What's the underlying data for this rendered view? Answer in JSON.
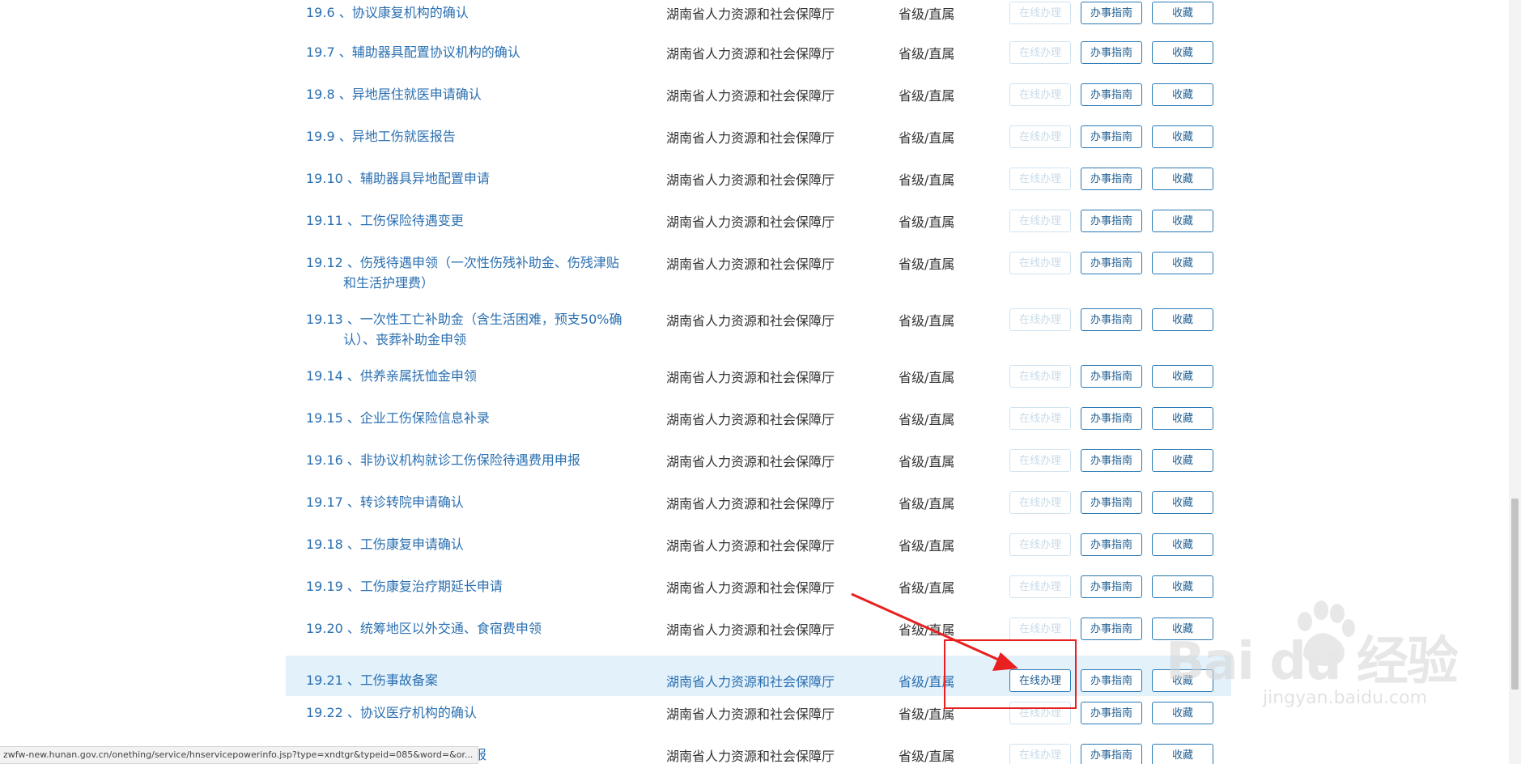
{
  "rows": [
    {
      "num": "19.6",
      "title": [
        "、协议康复机构的确认"
      ],
      "dept": "湖南省人力资源和社会保障厅",
      "level": "省级/直属",
      "online_enabled": false,
      "highlight": false
    },
    {
      "num": "19.7",
      "title": [
        "、辅助器具配置协议机构的确认"
      ],
      "dept": "湖南省人力资源和社会保障厅",
      "level": "省级/直属",
      "online_enabled": false,
      "highlight": false
    },
    {
      "num": "19.8",
      "title": [
        "、异地居住就医申请确认"
      ],
      "dept": "湖南省人力资源和社会保障厅",
      "level": "省级/直属",
      "online_enabled": false,
      "highlight": false
    },
    {
      "num": "19.9",
      "title": [
        "、异地工伤就医报告"
      ],
      "dept": "湖南省人力资源和社会保障厅",
      "level": "省级/直属",
      "online_enabled": false,
      "highlight": false
    },
    {
      "num": "19.10",
      "title": [
        "、辅助器具异地配置申请"
      ],
      "dept": "湖南省人力资源和社会保障厅",
      "level": "省级/直属",
      "online_enabled": false,
      "highlight": false
    },
    {
      "num": "19.11",
      "title": [
        "、工伤保险待遇变更"
      ],
      "dept": "湖南省人力资源和社会保障厅",
      "level": "省级/直属",
      "online_enabled": false,
      "highlight": false
    },
    {
      "num": "19.12",
      "title": [
        "、伤残待遇申领（一次性伤残补助金、伤残津贴",
        "和生活护理费）"
      ],
      "dept": "湖南省人力资源和社会保障厅",
      "level": "省级/直属",
      "online_enabled": false,
      "highlight": false
    },
    {
      "num": "19.13",
      "title": [
        "、一次性工亡补助金（含生活困难，预支50%确",
        "认）、丧葬补助金申领"
      ],
      "dept": "湖南省人力资源和社会保障厅",
      "level": "省级/直属",
      "online_enabled": false,
      "highlight": false
    },
    {
      "num": "19.14",
      "title": [
        "、供养亲属抚恤金申领"
      ],
      "dept": "湖南省人力资源和社会保障厅",
      "level": "省级/直属",
      "online_enabled": false,
      "highlight": false
    },
    {
      "num": "19.15",
      "title": [
        "、企业工伤保险信息补录"
      ],
      "dept": "湖南省人力资源和社会保障厅",
      "level": "省级/直属",
      "online_enabled": false,
      "highlight": false
    },
    {
      "num": "19.16",
      "title": [
        "、非协议机构就诊工伤保险待遇费用申报"
      ],
      "dept": "湖南省人力资源和社会保障厅",
      "level": "省级/直属",
      "online_enabled": false,
      "highlight": false
    },
    {
      "num": "19.17",
      "title": [
        "、转诊转院申请确认"
      ],
      "dept": "湖南省人力资源和社会保障厅",
      "level": "省级/直属",
      "online_enabled": false,
      "highlight": false
    },
    {
      "num": "19.18",
      "title": [
        "、工伤康复申请确认"
      ],
      "dept": "湖南省人力资源和社会保障厅",
      "level": "省级/直属",
      "online_enabled": false,
      "highlight": false
    },
    {
      "num": "19.19",
      "title": [
        "、工伤康复治疗期延长申请"
      ],
      "dept": "湖南省人力资源和社会保障厅",
      "level": "省级/直属",
      "online_enabled": false,
      "highlight": false
    },
    {
      "num": "19.20",
      "title": [
        "、统筹地区以外交通、食宿费申领"
      ],
      "dept": "湖南省人力资源和社会保障厅",
      "level": "省级/直属",
      "online_enabled": false,
      "highlight": false
    },
    {
      "num": "19.21",
      "title": [
        "、工伤事故备案"
      ],
      "dept": "湖南省人力资源和社会保障厅",
      "level": "省级/直属",
      "online_enabled": true,
      "highlight": true
    },
    {
      "num": "19.22",
      "title": [
        "、协议医疗机构的确认"
      ],
      "dept": "湖南省人力资源和社会保障厅",
      "level": "省级/直属",
      "online_enabled": false,
      "highlight": false
    },
    {
      "num": "",
      "title": [
        "遇费用申报"
      ],
      "dept": "湖南省人力资源和社会保障厅",
      "level": "省级/直属",
      "online_enabled": false,
      "highlight": false
    }
  ],
  "buttons": {
    "online_label": "在线办理",
    "guide_label": "办事指南",
    "favorite_label": "收藏"
  },
  "status_bar": {
    "url": "zwfw-new.hunan.gov.cn/onething/service/hnservicepowerinfo.jsp?type=xndtgr&typeid=085&word=&or..."
  },
  "watermark": {
    "logo": "Bai du 经验",
    "subtitle": "jingyan.baidu.com"
  },
  "colors": {
    "link": "#2a6fb0",
    "highlight_row": "#e3f1fb",
    "button_border": "#2a79b5",
    "annotation": "#e82020"
  }
}
